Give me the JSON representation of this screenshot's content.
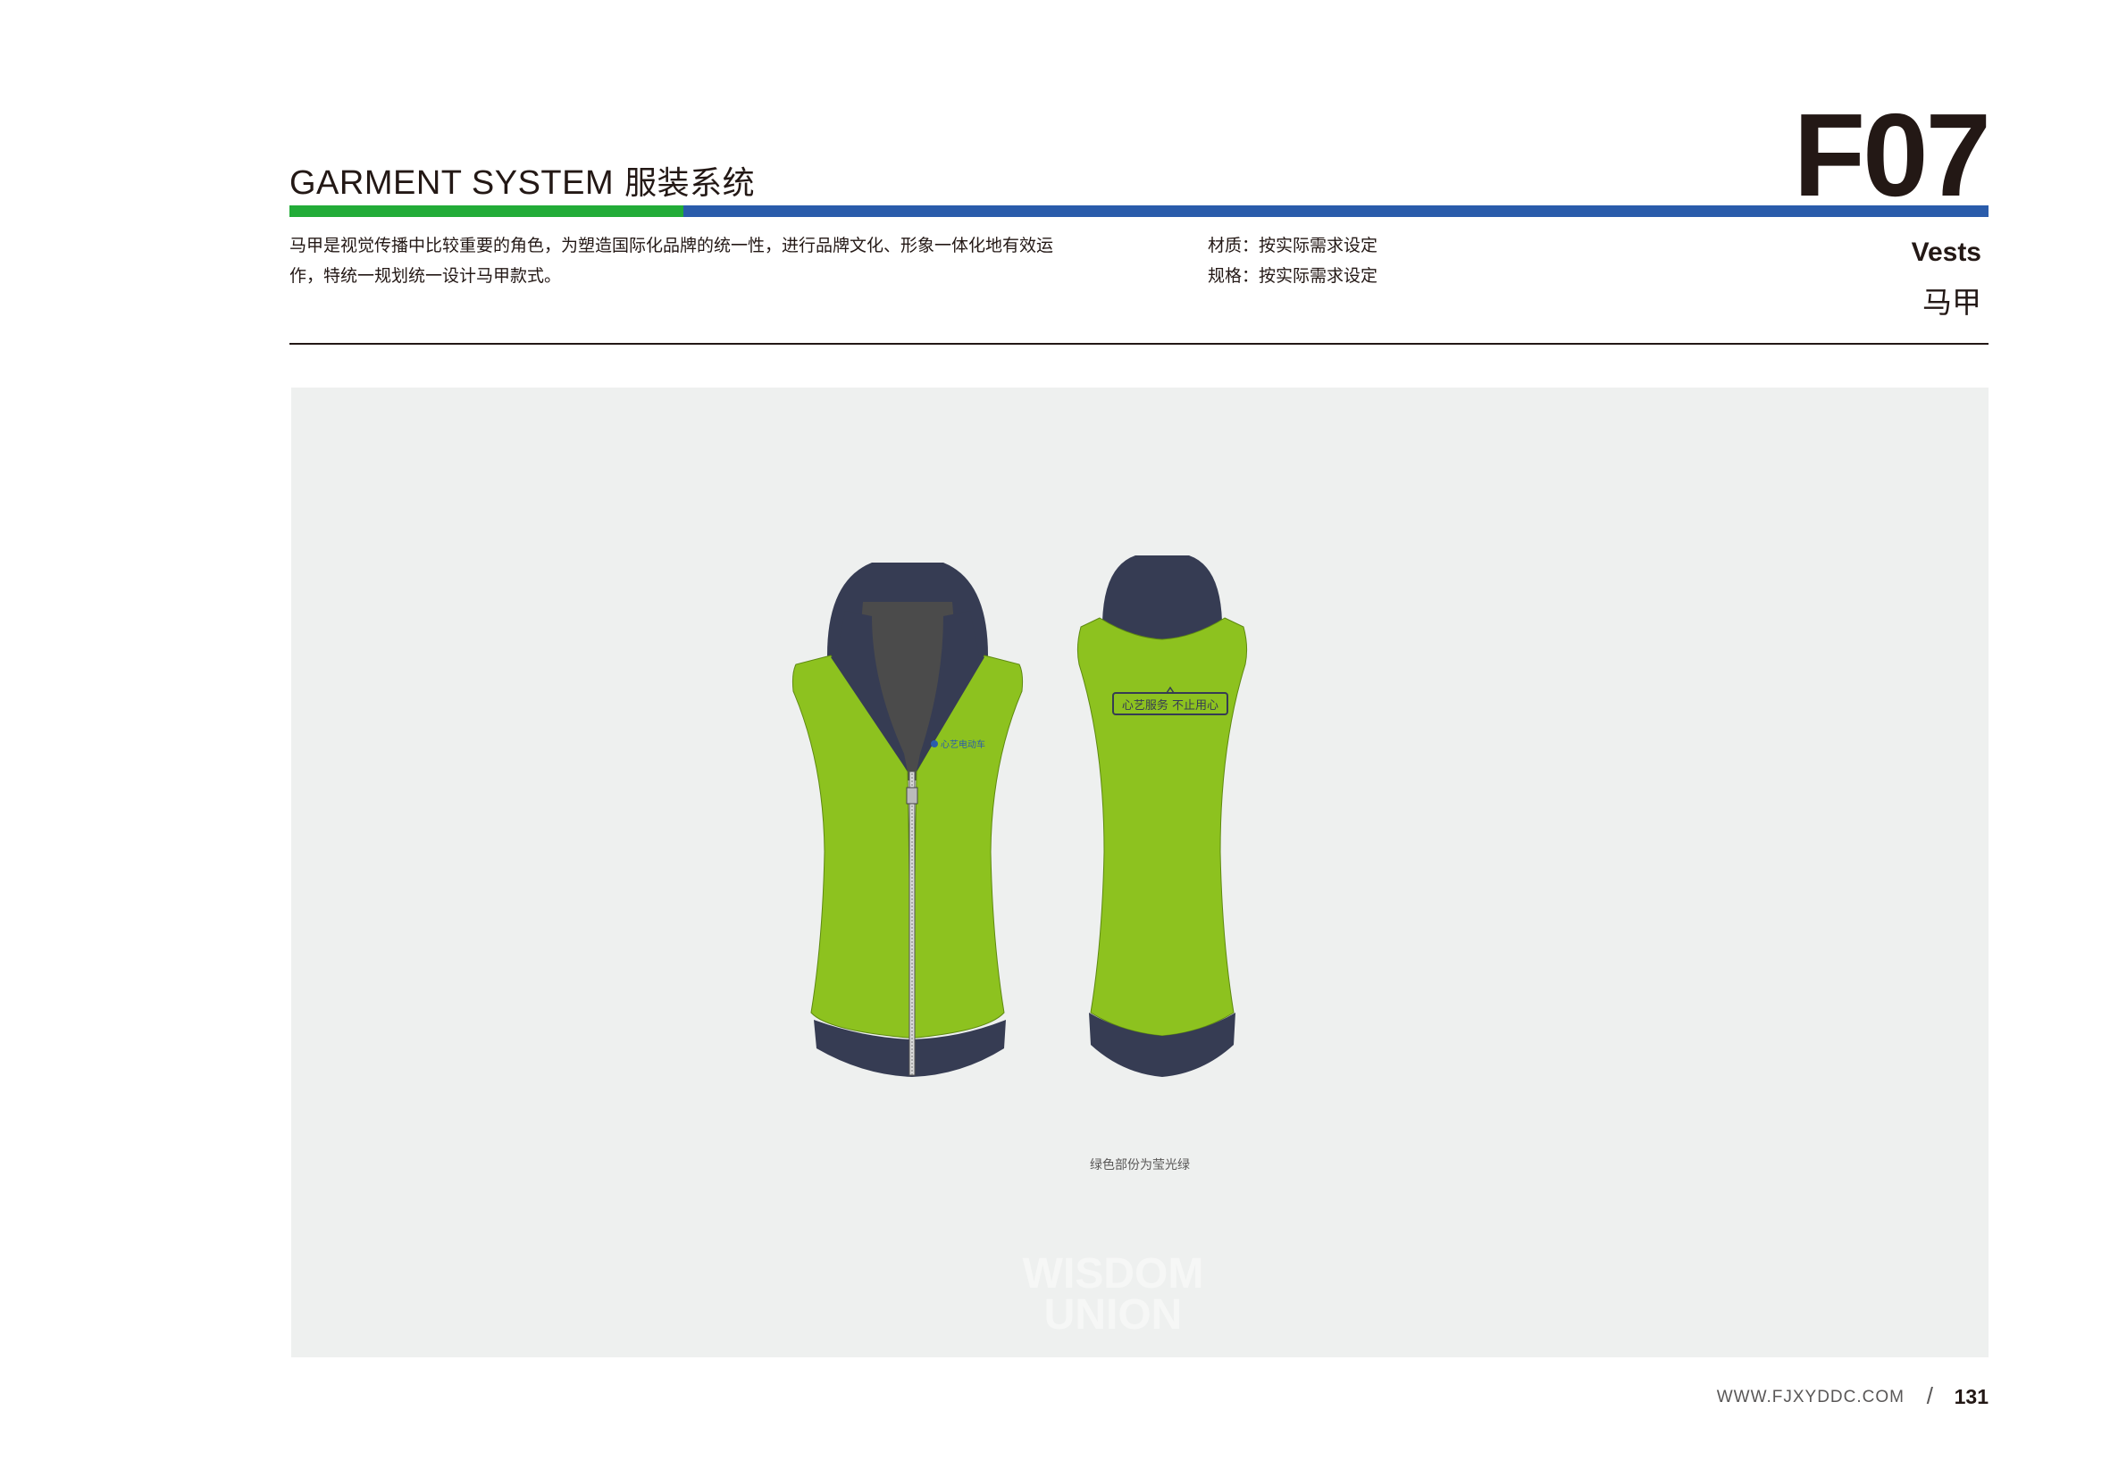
{
  "header": {
    "title_en": "GARMENT SYSTEM",
    "title_cn": "服装系统",
    "section_code": "F07"
  },
  "intro": {
    "line1": "马甲是视觉传播中比较重要的角色，为塑造国际化品牌的统一性，进行品牌文化、形象一体化地有效运",
    "line2": "作，特统一规划统一设计马甲款式。"
  },
  "spec": {
    "material": "材质：按实际需求设定",
    "size": "规格：按实际需求设定"
  },
  "category": {
    "en": "Vests",
    "cn": "马甲"
  },
  "garment": {
    "front_logo_text": "心艺电动车",
    "back_slogan": "心艺服务 不止用心",
    "colors": {
      "body": "#8dc21f",
      "trim": "#363c53",
      "lining": "#4b4b4b"
    }
  },
  "caption": "绿色部份为莹光绿",
  "watermark": {
    "line1": "WISDOM",
    "line2": "UNION"
  },
  "footer": {
    "url": "WWW.FJXYDDC.COM",
    "slash": "/",
    "page": "131"
  }
}
